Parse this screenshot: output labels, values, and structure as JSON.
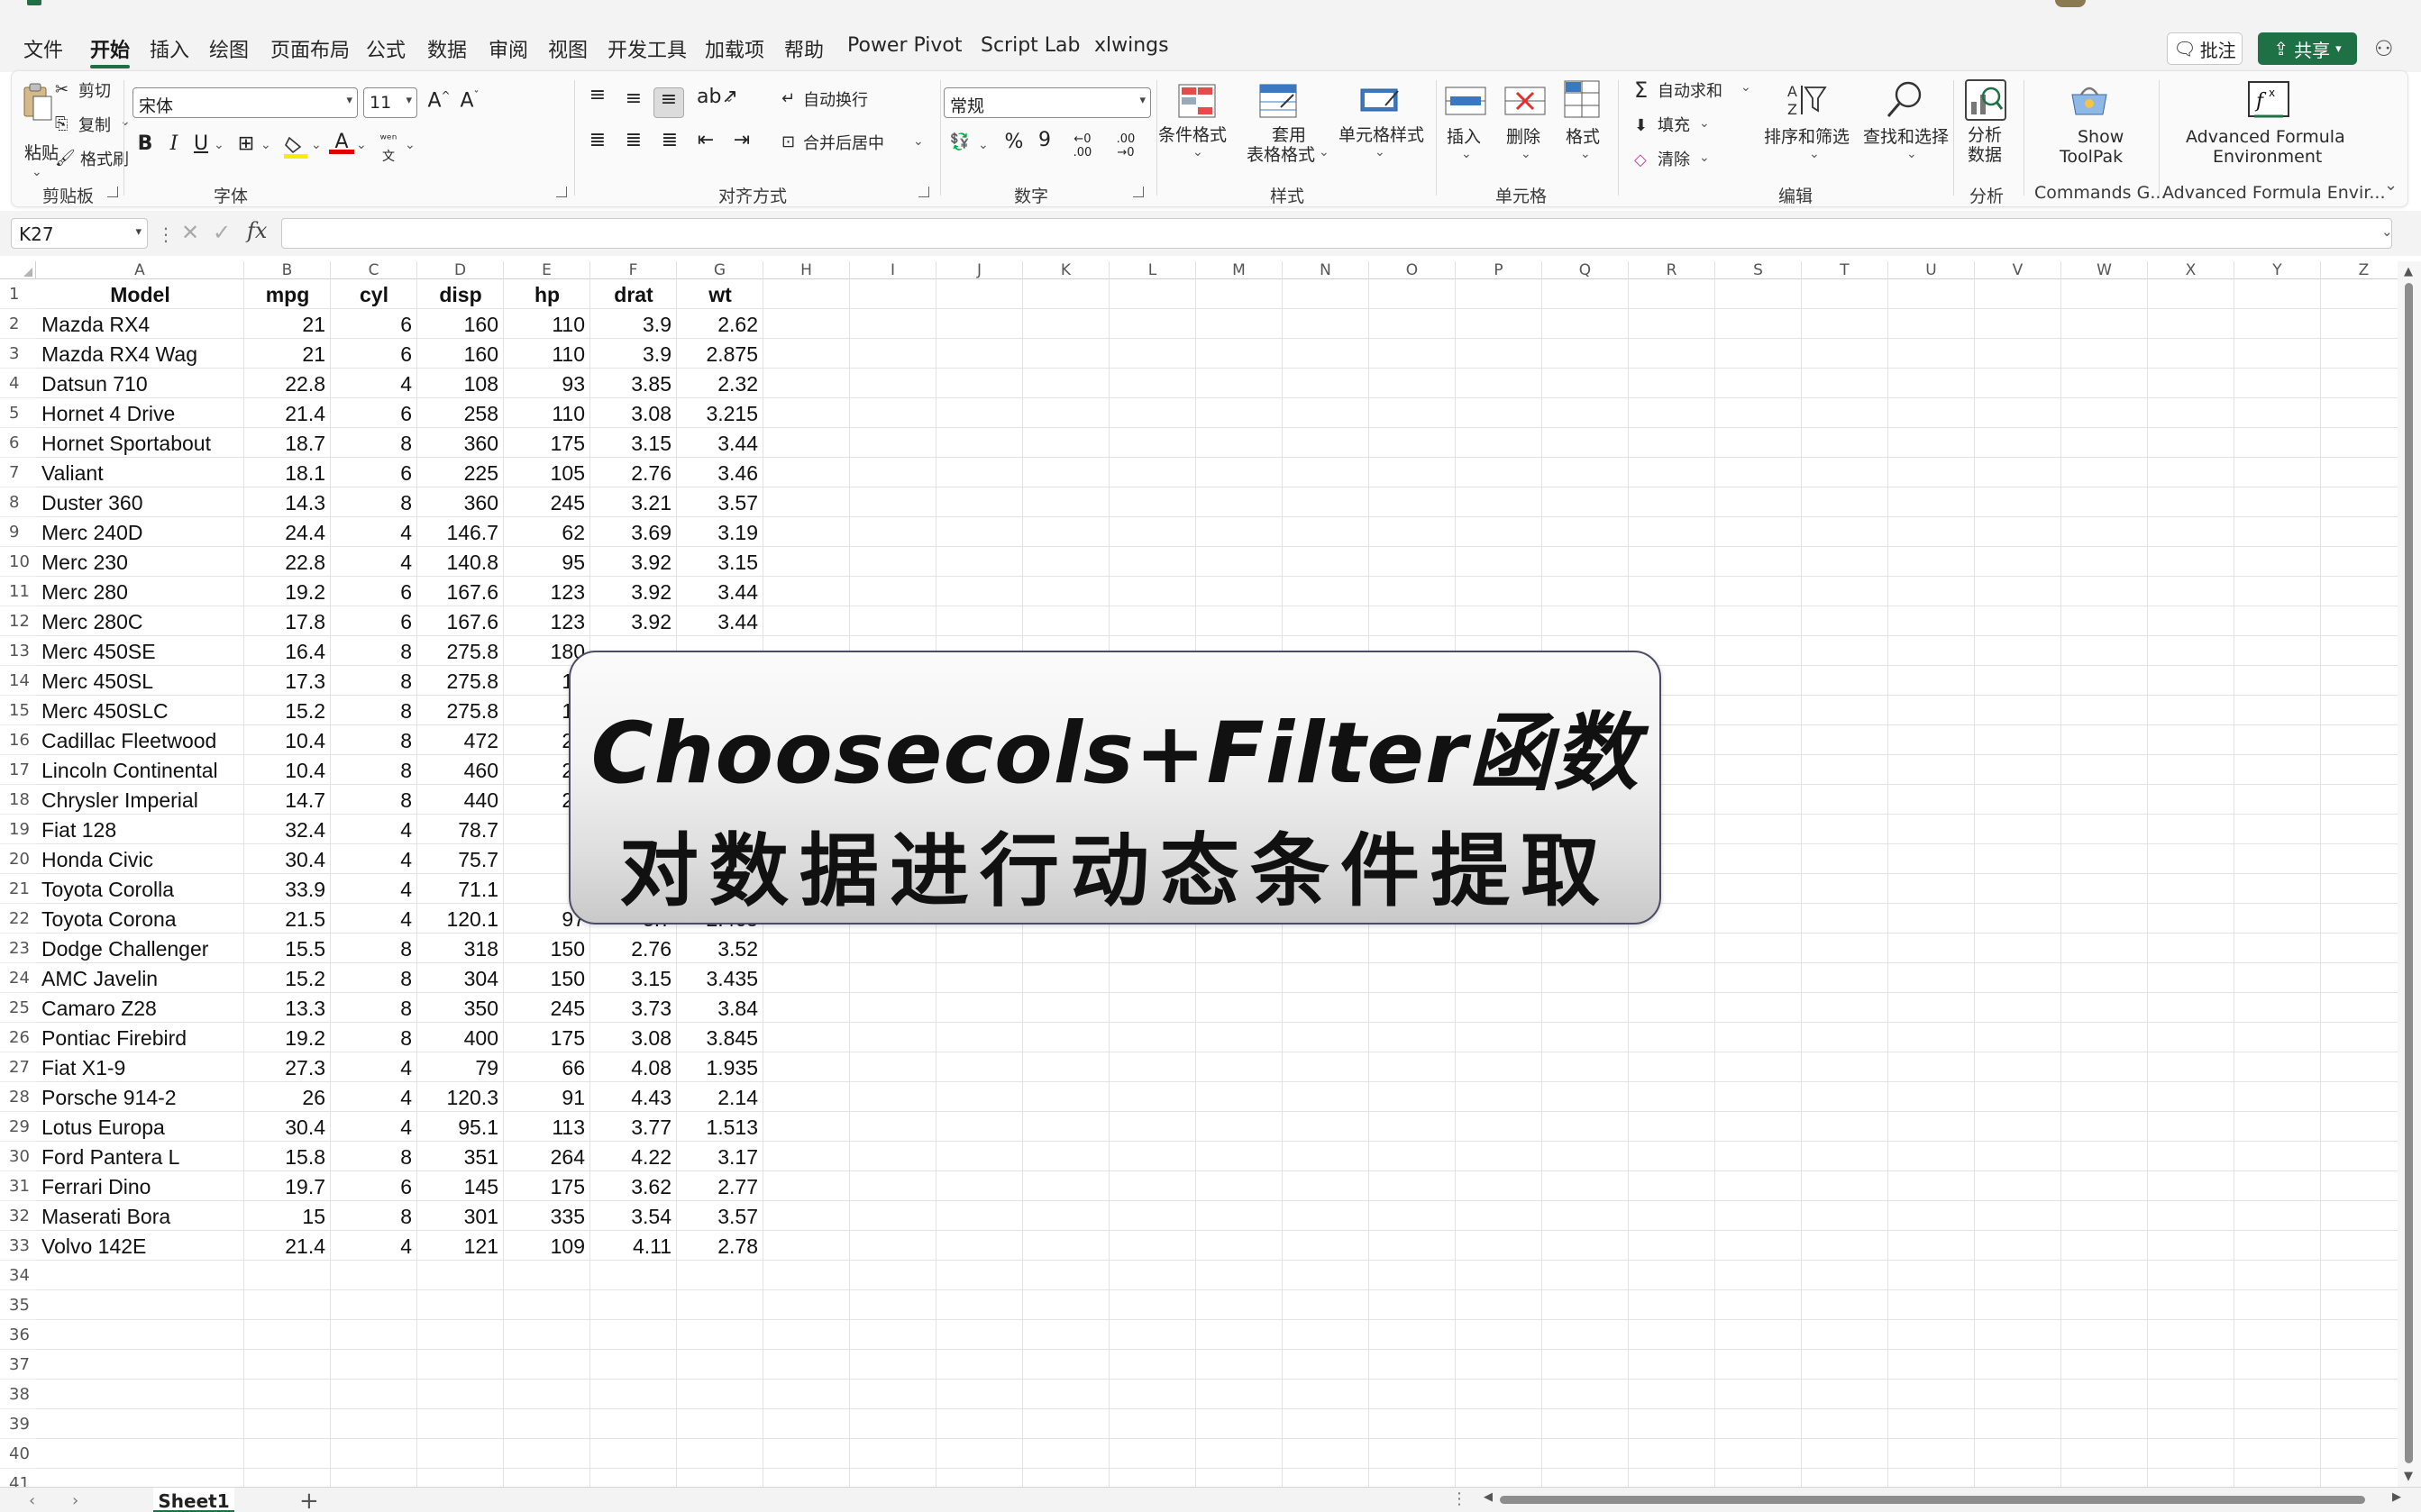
{
  "menu": {
    "tabs": [
      "文件",
      "开始",
      "插入",
      "绘图",
      "页面布局",
      "公式",
      "数据",
      "审阅",
      "视图",
      "开发工具",
      "加载项",
      "帮助",
      "Power Pivot",
      "Script Lab",
      "xlwings"
    ],
    "active_index": 1,
    "comment_label": "批注",
    "share_label": "共享"
  },
  "ribbon": {
    "clipboard": {
      "paste": "粘贴",
      "cut": "剪切",
      "copy": "复制",
      "format_painter": "格式刷",
      "label": "剪贴板"
    },
    "font": {
      "name": "宋体",
      "size": "11",
      "bold": "B",
      "italic": "I",
      "underline": "U",
      "label": "字体"
    },
    "alignment": {
      "wrap": "自动换行",
      "merge": "合并后居中",
      "label": "对齐方式"
    },
    "number": {
      "format": "常规",
      "label": "数字"
    },
    "styles": {
      "conditional": "条件格式",
      "table_line1": "套用",
      "table_line2": "表格格式",
      "cell_styles": "单元格样式",
      "label": "样式"
    },
    "cells": {
      "insert": "插入",
      "delete": "删除",
      "format": "格式",
      "label": "单元格"
    },
    "editing": {
      "autosum": "自动求和",
      "fill": "填充",
      "clear": "清除",
      "sort_filter": "排序和筛选",
      "find_select": "查找和选择",
      "label": "编辑"
    },
    "analysis": {
      "btn_line1": "分析",
      "btn_line2": "数据",
      "label": "分析"
    },
    "commands": {
      "btn_line1": "Show",
      "btn_line2": "ToolPak",
      "label": "Commands G..."
    },
    "afe": {
      "btn_line1": "Advanced Formula",
      "btn_line2": "Environment",
      "label": "Advanced Formula Envir..."
    }
  },
  "formula_bar": {
    "name_box": "K27",
    "fx": "fx",
    "formula": ""
  },
  "columns": [
    "A",
    "B",
    "C",
    "D",
    "E",
    "F",
    "G",
    "H",
    "I",
    "J",
    "K",
    "L",
    "M",
    "N",
    "O",
    "P",
    "Q",
    "R",
    "S",
    "T",
    "U",
    "V",
    "W",
    "X",
    "Y",
    "Z"
  ],
  "row_count": 42,
  "table": {
    "headers": [
      "Model",
      "mpg",
      "cyl",
      "disp",
      "hp",
      "drat",
      "wt"
    ],
    "rows": [
      [
        "Mazda RX4",
        "21",
        "6",
        "160",
        "110",
        "3.9",
        "2.62"
      ],
      [
        "Mazda RX4 Wag",
        "21",
        "6",
        "160",
        "110",
        "3.9",
        "2.875"
      ],
      [
        "Datsun 710",
        "22.8",
        "4",
        "108",
        "93",
        "3.85",
        "2.32"
      ],
      [
        "Hornet 4 Drive",
        "21.4",
        "6",
        "258",
        "110",
        "3.08",
        "3.215"
      ],
      [
        "Hornet Sportabout",
        "18.7",
        "8",
        "360",
        "175",
        "3.15",
        "3.44"
      ],
      [
        "Valiant",
        "18.1",
        "6",
        "225",
        "105",
        "2.76",
        "3.46"
      ],
      [
        "Duster 360",
        "14.3",
        "8",
        "360",
        "245",
        "3.21",
        "3.57"
      ],
      [
        "Merc 240D",
        "24.4",
        "4",
        "146.7",
        "62",
        "3.69",
        "3.19"
      ],
      [
        "Merc 230",
        "22.8",
        "4",
        "140.8",
        "95",
        "3.92",
        "3.15"
      ],
      [
        "Merc 280",
        "19.2",
        "6",
        "167.6",
        "123",
        "3.92",
        "3.44"
      ],
      [
        "Merc 280C",
        "17.8",
        "6",
        "167.6",
        "123",
        "3.92",
        "3.44"
      ],
      [
        "Merc 450SE",
        "16.4",
        "8",
        "275.8",
        "180",
        "",
        ""
      ],
      [
        "Merc 450SL",
        "17.3",
        "8",
        "275.8",
        "18",
        "",
        ""
      ],
      [
        "Merc 450SLC",
        "15.2",
        "8",
        "275.8",
        "18",
        "",
        ""
      ],
      [
        "Cadillac Fleetwood",
        "10.4",
        "8",
        "472",
        "20",
        "",
        ""
      ],
      [
        "Lincoln Continental",
        "10.4",
        "8",
        "460",
        "21",
        "",
        ""
      ],
      [
        "Chrysler Imperial",
        "14.7",
        "8",
        "440",
        "23",
        "",
        ""
      ],
      [
        "Fiat 128",
        "32.4",
        "4",
        "78.7",
        "6",
        "",
        ""
      ],
      [
        "Honda Civic",
        "30.4",
        "4",
        "75.7",
        "5",
        "",
        ""
      ],
      [
        "Toyota Corolla",
        "33.9",
        "4",
        "71.1",
        "6",
        "",
        ""
      ],
      [
        "Toyota Corona",
        "21.5",
        "4",
        "120.1",
        "97",
        "3.7",
        "2.465"
      ],
      [
        "Dodge Challenger",
        "15.5",
        "8",
        "318",
        "150",
        "2.76",
        "3.52"
      ],
      [
        "AMC Javelin",
        "15.2",
        "8",
        "304",
        "150",
        "3.15",
        "3.435"
      ],
      [
        "Camaro Z28",
        "13.3",
        "8",
        "350",
        "245",
        "3.73",
        "3.84"
      ],
      [
        "Pontiac Firebird",
        "19.2",
        "8",
        "400",
        "175",
        "3.08",
        "3.845"
      ],
      [
        "Fiat X1-9",
        "27.3",
        "4",
        "79",
        "66",
        "4.08",
        "1.935"
      ],
      [
        "Porsche 914-2",
        "26",
        "4",
        "120.3",
        "91",
        "4.43",
        "2.14"
      ],
      [
        "Lotus Europa",
        "30.4",
        "4",
        "95.1",
        "113",
        "3.77",
        "1.513"
      ],
      [
        "Ford Pantera L",
        "15.8",
        "8",
        "351",
        "264",
        "4.22",
        "3.17"
      ],
      [
        "Ferrari Dino",
        "19.7",
        "6",
        "145",
        "175",
        "3.62",
        "2.77"
      ],
      [
        "Maserati Bora",
        "15",
        "8",
        "301",
        "335",
        "3.54",
        "3.57"
      ],
      [
        "Volvo 142E",
        "21.4",
        "4",
        "121",
        "109",
        "4.11",
        "2.78"
      ]
    ]
  },
  "sheet_tabs": [
    "Sheet1"
  ],
  "banner": {
    "line1": "Choosecols+Filter函数",
    "line2": "对数据进行动态条件提取"
  },
  "colors": {
    "accent": "#1e7145"
  }
}
